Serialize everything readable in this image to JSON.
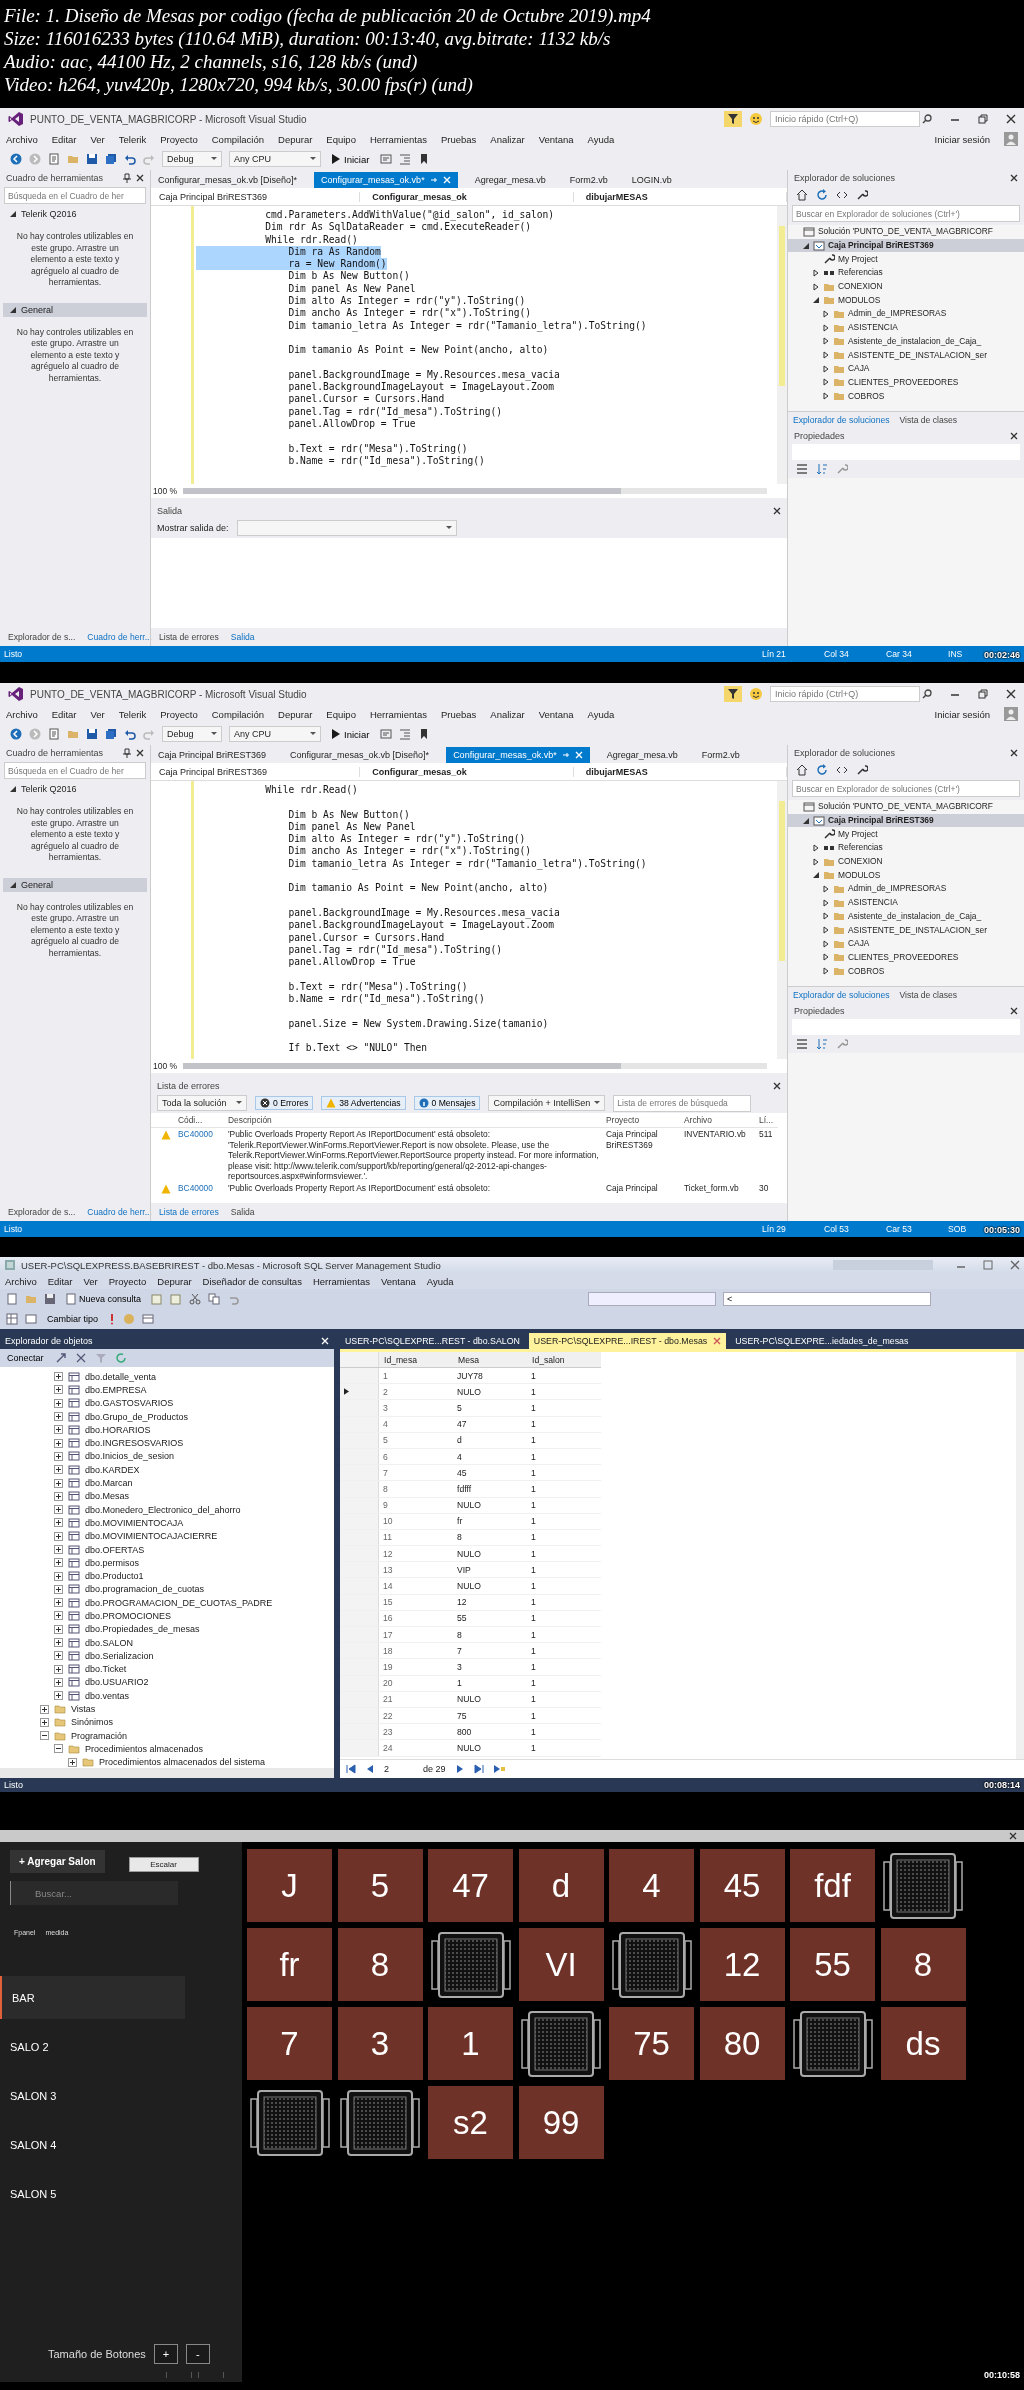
{
  "file_info": [
    "File: 1. Diseño de Mesas por codigo  (fecha de publicación 20 de Octubre 2019).mp4",
    "Size: 116016233 bytes (110.64 MiB), duration: 00:13:40, avg.bitrate: 1132 kb/s",
    "Audio: aac, 44100 Hz, 2 channels, s16, 128 kb/s (und)",
    "Video: h264, yuv420p, 1280x720, 994 kb/s, 30.00 fps(r) (und)"
  ],
  "frames": [
    {
      "kind": "vs",
      "timestamp": "00:02:46",
      "title": "PUNTO_DE_VENTA_MAGBRICORP - Microsoft Visual Studio",
      "quick_launch": {
        "placeholder": "Inicio rápido (Ctrl+Q)"
      },
      "sign_in": "Iniciar sesión",
      "menu": [
        "Archivo",
        "Editar",
        "Ver",
        "Telerik",
        "Proyecto",
        "Compilación",
        "Depurar",
        "Equipo",
        "Herramientas",
        "Pruebas",
        "Analizar",
        "Ventana",
        "Ayuda"
      ],
      "toolbar": {
        "configuration": "Debug",
        "platform": "Any CPU",
        "start": "Iniciar"
      },
      "toolbox": {
        "title": "Cuadro de herramientas",
        "search": {
          "placeholder": "Búsqueda en el Cuadro de her"
        },
        "groups": [
          {
            "name": "Telerik Q2016",
            "expanded": true,
            "selected": false,
            "message": "No hay controles utilizables en este grupo. Arrastre un elemento a este texto y agréguelo al cuadro de herramientas."
          },
          {
            "name": "General",
            "expanded": true,
            "selected": true,
            "message": "No hay controles utilizables en este grupo. Arrastre un elemento a este texto y agréguelo al cuadro de herramientas."
          }
        ]
      },
      "doc_tabs": [
        {
          "label": "Configurar_mesas_ok.vb [Diseño]*",
          "selected": false
        },
        {
          "label": "Configurar_mesas_ok.vb*",
          "selected": true
        },
        {
          "label": "Agregar_mesa.vb",
          "selected": false
        },
        {
          "label": "Form2.vb",
          "selected": false
        },
        {
          "label": "LOGIN.vb",
          "selected": false
        }
      ],
      "navigation": [
        "Caja Principal BriREST369",
        "Configurar_mesas_ok",
        "dibujarMESAS"
      ],
      "code_blocks": [
        [
          {
            "text": "            cmd.Parameters.AddWithValue(\"@id_salon\", id_salon)",
            "selected": false
          },
          {
            "text": "            Dim rdr As SqlDataReader = cmd.ExecuteReader()",
            "selected": false
          },
          {
            "text": "            While rdr.Read()",
            "selected": false
          },
          {
            "text": "                Dim ra As Random",
            "selected": true
          },
          {
            "text": "                ra = New Random()",
            "selected": true
          },
          {
            "text": "                Dim b As New Button()",
            "selected": false
          },
          {
            "text": "                Dim panel As New Panel",
            "selected": false
          },
          {
            "text": "                Dim alto As Integer = rdr(\"y\").ToString()",
            "selected": false
          },
          {
            "text": "                Dim ancho As Integer = rdr(\"x\").ToString()",
            "selected": false
          },
          {
            "text": "                Dim tamanio_letra As Integer = rdr(\"Tamanio_letra\").ToString()",
            "selected": false
          }
        ],
        [
          {
            "text": "                Dim tamanio As Point = New Point(ancho, alto)",
            "selected": false
          }
        ],
        [
          {
            "text": "                panel.BackgroundImage = My.Resources.mesa_vacia",
            "selected": false
          },
          {
            "text": "                panel.BackgroundImageLayout = ImageLayout.Zoom",
            "selected": false
          },
          {
            "text": "                panel.Cursor = Cursors.Hand",
            "selected": false
          },
          {
            "text": "                panel.Tag = rdr(\"Id_mesa\").ToString()",
            "selected": false
          },
          {
            "text": "                panel.AllowDrop = True",
            "selected": false
          }
        ],
        [
          {
            "text": "                b.Text = rdr(\"Mesa\").ToString()",
            "selected": false
          },
          {
            "text": "                b.Name = rdr(\"Id_mesa\").ToString()",
            "selected": false
          }
        ]
      ],
      "zoom": "100 %",
      "bottom_panel": {
        "kind": "output",
        "title": "Salida",
        "label": "Mostrar salida de:"
      },
      "left_tabs": [
        {
          "label": "Explorador de s...",
          "selected": false
        },
        {
          "label": "Cuadro de herr...",
          "selected": true
        }
      ],
      "bottom_tabs": [
        {
          "label": "Lista de errores",
          "selected": false
        },
        {
          "label": "Salida",
          "selected": true
        }
      ],
      "solution": {
        "title": "Explorador de soluciones",
        "search": {
          "placeholder": "Buscar en Explorador de soluciones (Ctrl+')"
        },
        "tree": [
          {
            "label": "Solución 'PUNTO_DE_VENTA_MAGBRICORF",
            "kind": "solution",
            "selected": false,
            "children": [
              {
                "label": "Caja Principal BriREST369",
                "kind": "project",
                "expanded": true,
                "selected": true,
                "children": [
                  {
                    "label": "My Project",
                    "kind": "properties",
                    "selected": false
                  },
                  {
                    "label": "Referencias",
                    "kind": "references",
                    "expanded": false,
                    "selected": false
                  },
                  {
                    "label": "CONEXION",
                    "kind": "folder",
                    "expanded": false,
                    "selected": false
                  },
                  {
                    "label": "MODULOS",
                    "kind": "folder",
                    "expanded": true,
                    "selected": false,
                    "children": [
                      {
                        "label": "Admin_de_IMPRESORAS",
                        "kind": "folder",
                        "expanded": false,
                        "selected": false
                      },
                      {
                        "label": "ASISTENCIA",
                        "kind": "folder",
                        "expanded": false,
                        "selected": false
                      },
                      {
                        "label": "Asistente_de_instalacion_de_Caja_",
                        "kind": "folder",
                        "expanded": false,
                        "selected": false
                      },
                      {
                        "label": "ASISTENTE_DE_INSTALACION_ser",
                        "kind": "folder",
                        "expanded": false,
                        "selected": false
                      },
                      {
                        "label": "CAJA",
                        "kind": "folder",
                        "expanded": false,
                        "selected": false
                      },
                      {
                        "label": "CLIENTES_PROVEEDORES",
                        "kind": "folder",
                        "expanded": false,
                        "selected": false
                      },
                      {
                        "label": "COBROS",
                        "kind": "folder",
                        "expanded": false,
                        "selected": false
                      }
                    ]
                  }
                ]
              }
            ]
          }
        ]
      },
      "solution_tabs": [
        {
          "label": "Explorador de soluciones",
          "selected": true
        },
        {
          "label": "Vista de clases",
          "selected": false
        }
      ],
      "properties": {
        "title": "Propiedades"
      },
      "status": [
        "Listo",
        "Lín 21",
        "Col 34",
        "Car 34",
        "INS"
      ]
    },
    {
      "kind": "vs",
      "timestamp": "00:05:30",
      "title": "PUNTO_DE_VENTA_MAGBRICORP - Microsoft Visual Studio",
      "quick_launch": {
        "placeholder": "Inicio rápido (Ctrl+Q)"
      },
      "sign_in": "Iniciar sesión",
      "menu": [
        "Archivo",
        "Editar",
        "Ver",
        "Telerik",
        "Proyecto",
        "Compilación",
        "Depurar",
        "Equipo",
        "Herramientas",
        "Pruebas",
        "Analizar",
        "Ventana",
        "Ayuda"
      ],
      "toolbar": {
        "configuration": "Debug",
        "platform": "Any CPU",
        "start": "Iniciar"
      },
      "toolbox": {
        "title": "Cuadro de herramientas",
        "search": {
          "placeholder": "Búsqueda en el Cuadro de her"
        },
        "groups": [
          {
            "name": "Telerik Q2016",
            "expanded": true,
            "selected": false,
            "message": "No hay controles utilizables en este grupo. Arrastre un elemento a este texto y agréguelo al cuadro de herramientas."
          },
          {
            "name": "General",
            "expanded": true,
            "selected": true,
            "message": "No hay controles utilizables en este grupo. Arrastre un elemento a este texto y agréguelo al cuadro de herramientas."
          }
        ]
      },
      "doc_tabs": [
        {
          "label": "Caja Principal BriREST369",
          "selected": false
        },
        {
          "label": "Configurar_mesas_ok.vb [Diseño]*",
          "selected": false
        },
        {
          "label": "Configurar_mesas_ok.vb*",
          "selected": true
        },
        {
          "label": "Agregar_mesa.vb",
          "selected": false
        },
        {
          "label": "Form2.vb",
          "selected": false
        }
      ],
      "navigation": [
        "Caja Principal BriREST369",
        "Configurar_mesas_ok",
        "dibujarMESAS"
      ],
      "code_blocks": [
        [
          {
            "text": "            While rdr.Read()",
            "selected": false
          }
        ],
        [
          {
            "text": "                Dim b As New Button()",
            "selected": false
          },
          {
            "text": "                Dim panel As New Panel",
            "selected": false
          },
          {
            "text": "                Dim alto As Integer = rdr(\"y\").ToString()",
            "selected": false
          },
          {
            "text": "                Dim ancho As Integer = rdr(\"x\").ToString()",
            "selected": false
          },
          {
            "text": "                Dim tamanio_letra As Integer = rdr(\"Tamanio_letra\").ToString()",
            "selected": false
          }
        ],
        [
          {
            "text": "                Dim tamanio As Point = New Point(ancho, alto)",
            "selected": false
          }
        ],
        [
          {
            "text": "                panel.BackgroundImage = My.Resources.mesa_vacia",
            "selected": false
          },
          {
            "text": "                panel.BackgroundImageLayout = ImageLayout.Zoom",
            "selected": false
          },
          {
            "text": "                panel.Cursor = Cursors.Hand",
            "selected": false
          },
          {
            "text": "                panel.Tag = rdr(\"Id_mesa\").ToString()",
            "selected": false
          },
          {
            "text": "                panel.AllowDrop = True",
            "selected": false
          }
        ],
        [
          {
            "text": "                b.Text = rdr(\"Mesa\").ToString()",
            "selected": false
          },
          {
            "text": "                b.Name = rdr(\"Id_mesa\").ToString()",
            "selected": false
          }
        ],
        [
          {
            "text": "                panel.Size = New System.Drawing.Size(tamanio)",
            "selected": false
          }
        ],
        [
          {
            "text": "                If b.Text <> \"NULO\" Then",
            "selected": false
          }
        ]
      ],
      "zoom": "100 %",
      "bottom_panel": {
        "kind": "errors",
        "title": "Lista de errores",
        "scope": "Toda la solución",
        "filters": [
          {
            "label": "0 Errores",
            "kind": "error",
            "selected": true
          },
          {
            "label": "38 Advertencias",
            "kind": "warning",
            "selected": true
          },
          {
            "label": "0 Mensajes",
            "kind": "info",
            "selected": true
          }
        ],
        "build_filter": "Compilación + IntelliSen",
        "search": {
          "placeholder": "Lista de errores de búsqueda"
        },
        "columns": [
          "Códi...",
          "Descripción",
          "Proyecto",
          "Archivo",
          "Lí..."
        ],
        "rows": [
          {
            "code": "BC40000",
            "description": "'Public Overloads Property Report As IReportDocument' está obsoleto: 'Telerik.ReportViewer.WinForms.ReportViewer.Report is now obsolete. Please, use the Telerik.ReportViewer.WinForms.ReportViewer.ReportSource property instead. For more information, please visit: http://www.telerik.com/support/kb/reporting/general/q2-2012-api-changes-reportsources.aspx#winformsviewer.'.",
            "project": "Caja Principal BriREST369",
            "file": "INVENTARIO.vb",
            "line": "511"
          },
          {
            "code": "BC40000",
            "description": "'Public Overloads Property Report As IReportDocument' está obsoleto:",
            "project": "Caja Principal",
            "file": "Ticket_form.vb",
            "line": "30"
          }
        ]
      },
      "left_tabs": [
        {
          "label": "Explorador de s...",
          "selected": false
        },
        {
          "label": "Cuadro de herr...",
          "selected": true
        }
      ],
      "bottom_tabs": [
        {
          "label": "Lista de errores",
          "selected": true
        },
        {
          "label": "Salida",
          "selected": false
        }
      ],
      "solution": {
        "title": "Explorador de soluciones",
        "search": {
          "placeholder": "Buscar en Explorador de soluciones (Ctrl+')"
        },
        "tree": [
          {
            "label": "Solución 'PUNTO_DE_VENTA_MAGBRICORF",
            "kind": "solution",
            "selected": false,
            "children": [
              {
                "label": "Caja Principal BriREST369",
                "kind": "project",
                "expanded": true,
                "selected": true,
                "children": [
                  {
                    "label": "My Project",
                    "kind": "properties",
                    "selected": false
                  },
                  {
                    "label": "Referencias",
                    "kind": "references",
                    "expanded": false,
                    "selected": false
                  },
                  {
                    "label": "CONEXION",
                    "kind": "folder",
                    "expanded": false,
                    "selected": false
                  },
                  {
                    "label": "MODULOS",
                    "kind": "folder",
                    "expanded": true,
                    "selected": false,
                    "children": [
                      {
                        "label": "Admin_de_IMPRESORAS",
                        "kind": "folder",
                        "expanded": false,
                        "selected": false
                      },
                      {
                        "label": "ASISTENCIA",
                        "kind": "folder",
                        "expanded": false,
                        "selected": false
                      },
                      {
                        "label": "Asistente_de_instalacion_de_Caja_",
                        "kind": "folder",
                        "expanded": false,
                        "selected": false
                      },
                      {
                        "label": "ASISTENTE_DE_INSTALACION_ser",
                        "kind": "folder",
                        "expanded": false,
                        "selected": false
                      },
                      {
                        "label": "CAJA",
                        "kind": "folder",
                        "expanded": false,
                        "selected": false
                      },
                      {
                        "label": "CLIENTES_PROVEEDORES",
                        "kind": "folder",
                        "expanded": false,
                        "selected": false
                      },
                      {
                        "label": "COBROS",
                        "kind": "folder",
                        "expanded": false,
                        "selected": false
                      }
                    ]
                  }
                ]
              }
            ]
          }
        ]
      },
      "solution_tabs": [
        {
          "label": "Explorador de soluciones",
          "selected": true
        },
        {
          "label": "Vista de clases",
          "selected": false
        }
      ],
      "properties": {
        "title": "Propiedades"
      },
      "status": [
        "Listo",
        "Lín 29",
        "Col 53",
        "Car 53",
        "SOB"
      ]
    },
    {
      "kind": "ssms",
      "timestamp": "00:08:14",
      "title": "USER-PC\\SQLEXPRESS.BASEBRIREST - dbo.Mesas - Microsoft SQL Server Management Studio",
      "menu": [
        "Archivo",
        "Editar",
        "Ver",
        "Proyecto",
        "Depurar",
        "Diseñador de consultas",
        "Herramientas",
        "Ventana",
        "Ayuda"
      ],
      "new_query": "Nueva consulta",
      "change_type": "Cambiar tipo",
      "query_combo": "<",
      "explorer": {
        "title": "Explorador de objetos",
        "connect": "Conectar",
        "tree": [
          {
            "label": "dbo.detalle_venta",
            "kind": "table",
            "expanded": false
          },
          {
            "label": "dbo.EMPRESA",
            "kind": "table",
            "expanded": false
          },
          {
            "label": "dbo.GASTOSVARIOS",
            "kind": "table",
            "expanded": false
          },
          {
            "label": "dbo.Grupo_de_Productos",
            "kind": "table",
            "expanded": false
          },
          {
            "label": "dbo.HORARIOS",
            "kind": "table",
            "expanded": false
          },
          {
            "label": "dbo.INGRESOSVARIOS",
            "kind": "table",
            "expanded": false
          },
          {
            "label": "dbo.Inicios_de_sesion",
            "kind": "table",
            "expanded": false
          },
          {
            "label": "dbo.KARDEX",
            "kind": "table",
            "expanded": false
          },
          {
            "label": "dbo.Marcan",
            "kind": "table",
            "expanded": false
          },
          {
            "label": "dbo.Mesas",
            "kind": "table",
            "expanded": false
          },
          {
            "label": "dbo.Monedero_Electronico_del_ahorro",
            "kind": "table",
            "expanded": false
          },
          {
            "label": "dbo.MOVIMIENTOCAJA",
            "kind": "table",
            "expanded": false
          },
          {
            "label": "dbo.MOVIMIENTOCAJACIERRE",
            "kind": "table",
            "expanded": false
          },
          {
            "label": "dbo.OFERTAS",
            "kind": "table",
            "expanded": false
          },
          {
            "label": "dbo.permisos",
            "kind": "table",
            "expanded": false
          },
          {
            "label": "dbo.Producto1",
            "kind": "table",
            "expanded": false
          },
          {
            "label": "dbo.programacion_de_cuotas",
            "kind": "table",
            "expanded": false
          },
          {
            "label": "dbo.PROGRAMACION_DE_CUOTAS_PADRE",
            "kind": "table",
            "expanded": false
          },
          {
            "label": "dbo.PROMOCIONES",
            "kind": "table",
            "expanded": false
          },
          {
            "label": "dbo.Propiedades_de_mesas",
            "kind": "table",
            "expanded": false
          },
          {
            "label": "dbo.SALON",
            "kind": "table",
            "expanded": false
          },
          {
            "label": "dbo.Serializacion",
            "kind": "table",
            "expanded": false
          },
          {
            "label": "dbo.Ticket",
            "kind": "table",
            "expanded": false
          },
          {
            "label": "dbo.USUARIO2",
            "kind": "table",
            "expanded": false
          },
          {
            "label": "dbo.ventas",
            "kind": "table",
            "expanded": false
          },
          {
            "label": "Vistas",
            "kind": "folder",
            "expanded": false
          },
          {
            "label": "Sinónimos",
            "kind": "folder",
            "expanded": false
          },
          {
            "label": "Programación",
            "kind": "folder",
            "expanded": true,
            "children": [
              {
                "label": "Procedimientos almacenados",
                "kind": "folder",
                "expanded": true,
                "children": [
                  {
                    "label": "Procedimientos almacenados del sistema",
                    "kind": "folder",
                    "expanded": false
                  }
                ]
              }
            ]
          }
        ]
      },
      "doc_tabs": [
        {
          "label": "USER-PC\\SQLEXPRE...REST - dbo.SALON",
          "selected": false
        },
        {
          "label": "USER-PC\\SQLEXPRE...IREST - dbo.Mesas",
          "selected": true
        },
        {
          "label": "USER-PC\\SQLEXPRE...iedades_de_mesas",
          "selected": false
        }
      ],
      "columns": [
        "Id_mesa",
        "Mesa",
        "Id_salon"
      ],
      "rows": [
        {
          "cells": [
            "1",
            "JUY78",
            "1"
          ],
          "selected": false
        },
        {
          "cells": [
            "2",
            "NULO",
            "1"
          ],
          "selected": true
        },
        {
          "cells": [
            "3",
            "5",
            "1"
          ],
          "selected": false
        },
        {
          "cells": [
            "4",
            "47",
            "1"
          ],
          "selected": false
        },
        {
          "cells": [
            "5",
            "d",
            "1"
          ],
          "selected": false
        },
        {
          "cells": [
            "6",
            "4",
            "1"
          ],
          "selected": false
        },
        {
          "cells": [
            "7",
            "45",
            "1"
          ],
          "selected": false
        },
        {
          "cells": [
            "8",
            "fdfff",
            "1"
          ],
          "selected": false
        },
        {
          "cells": [
            "9",
            "NULO",
            "1"
          ],
          "selected": false
        },
        {
          "cells": [
            "10",
            "fr",
            "1"
          ],
          "selected": false
        },
        {
          "cells": [
            "11",
            "8",
            "1"
          ],
          "selected": false
        },
        {
          "cells": [
            "12",
            "NULO",
            "1"
          ],
          "selected": false
        },
        {
          "cells": [
            "13",
            "VIP",
            "1"
          ],
          "selected": false
        },
        {
          "cells": [
            "14",
            "NULO",
            "1"
          ],
          "selected": false
        },
        {
          "cells": [
            "15",
            "12",
            "1"
          ],
          "selected": false
        },
        {
          "cells": [
            "16",
            "55",
            "1"
          ],
          "selected": false
        },
        {
          "cells": [
            "17",
            "8",
            "1"
          ],
          "selected": false
        },
        {
          "cells": [
            "18",
            "7",
            "1"
          ],
          "selected": false
        },
        {
          "cells": [
            "19",
            "3",
            "1"
          ],
          "selected": false
        },
        {
          "cells": [
            "20",
            "1",
            "1"
          ],
          "selected": false
        },
        {
          "cells": [
            "21",
            "NULO",
            "1"
          ],
          "selected": false
        },
        {
          "cells": [
            "22",
            "75",
            "1"
          ],
          "selected": false
        },
        {
          "cells": [
            "23",
            "800",
            "1"
          ],
          "selected": false
        },
        {
          "cells": [
            "24",
            "NULO",
            "1"
          ],
          "selected": false
        }
      ],
      "record": "2",
      "record_total": "de 29",
      "status": "Listo"
    },
    {
      "kind": "pos",
      "timestamp": "00:10:58",
      "add_button": "+ Agregar Salon",
      "scale_button": "Escalar",
      "search": {
        "placeholder": "Buscar..."
      },
      "labels": [
        "Fpanel",
        "medida"
      ],
      "salons": [
        {
          "label": "BAR",
          "selected": true
        },
        {
          "label": "SALO 2",
          "selected": false
        },
        {
          "label": "SALON 3",
          "selected": false
        },
        {
          "label": "SALON 4",
          "selected": false
        },
        {
          "label": "SALON 5",
          "selected": false
        }
      ],
      "size_label": "Tamaño de Botones",
      "size_buttons": [
        "+",
        "-"
      ],
      "tables": [
        {
          "kind": "mesa",
          "label": "J"
        },
        {
          "kind": "mesa",
          "label": "5"
        },
        {
          "kind": "mesa",
          "label": "47"
        },
        {
          "kind": "mesa",
          "label": "d"
        },
        {
          "kind": "mesa",
          "label": "4"
        },
        {
          "kind": "mesa",
          "label": "45"
        },
        {
          "kind": "mesa",
          "label": "fdf"
        },
        {
          "kind": "empty"
        },
        {
          "kind": "mesa",
          "label": "fr"
        },
        {
          "kind": "mesa",
          "label": "8"
        },
        {
          "kind": "empty"
        },
        {
          "kind": "mesa",
          "label": "VI"
        },
        {
          "kind": "empty"
        },
        {
          "kind": "mesa",
          "label": "12"
        },
        {
          "kind": "mesa",
          "label": "55"
        },
        {
          "kind": "mesa",
          "label": "8"
        },
        {
          "kind": "mesa",
          "label": "7"
        },
        {
          "kind": "mesa",
          "label": "3"
        },
        {
          "kind": "mesa",
          "label": "1"
        },
        {
          "kind": "empty"
        },
        {
          "kind": "mesa",
          "label": "75"
        },
        {
          "kind": "mesa",
          "label": "80"
        },
        {
          "kind": "empty"
        },
        {
          "kind": "mesa",
          "label": "ds"
        },
        {
          "kind": "empty"
        },
        {
          "kind": "empty"
        },
        {
          "kind": "mesa",
          "label": "s2"
        },
        {
          "kind": "mesa",
          "label": "99"
        }
      ]
    }
  ]
}
